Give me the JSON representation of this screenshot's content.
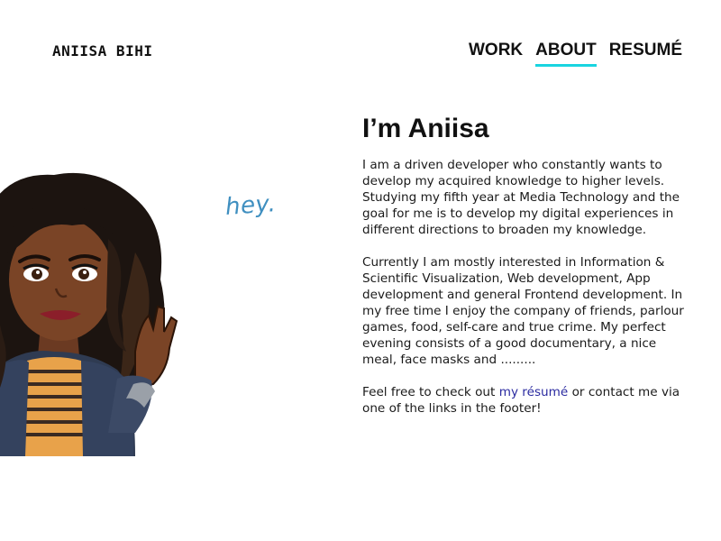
{
  "header": {
    "brand": "ANIISA BIHI",
    "nav": [
      {
        "label": "WORK",
        "active": false
      },
      {
        "label": "ABOUT",
        "active": true
      },
      {
        "label": "RESUMÉ",
        "active": false
      }
    ],
    "accent_color": "#19d4e0"
  },
  "illustration": {
    "speech_text": "hey.",
    "icon": "avatar-waving-icon"
  },
  "about": {
    "heading": "I’m Aniisa",
    "paragraph1": "I am a driven developer who constantly wants to develop my acquired knowledge to higher levels. Studying my fifth year at Media Technology and the goal for me is to develop my digital experiences in different directions to broaden my knowledge.",
    "paragraph2": "Currently I am mostly interested in Information & Scientific Visualization, Web development, App development and general Frontend development. In my free time I enjoy the company of friends, parlour games, food, self-care and true crime. My perfect evening consists of a good documentary, a nice meal, face masks and .........",
    "paragraph3_before": "Feel free to check out ",
    "paragraph3_link": "my résumé",
    "paragraph3_after": " or contact me via one of the links in the footer!",
    "link_color": "#2a2aa0"
  }
}
